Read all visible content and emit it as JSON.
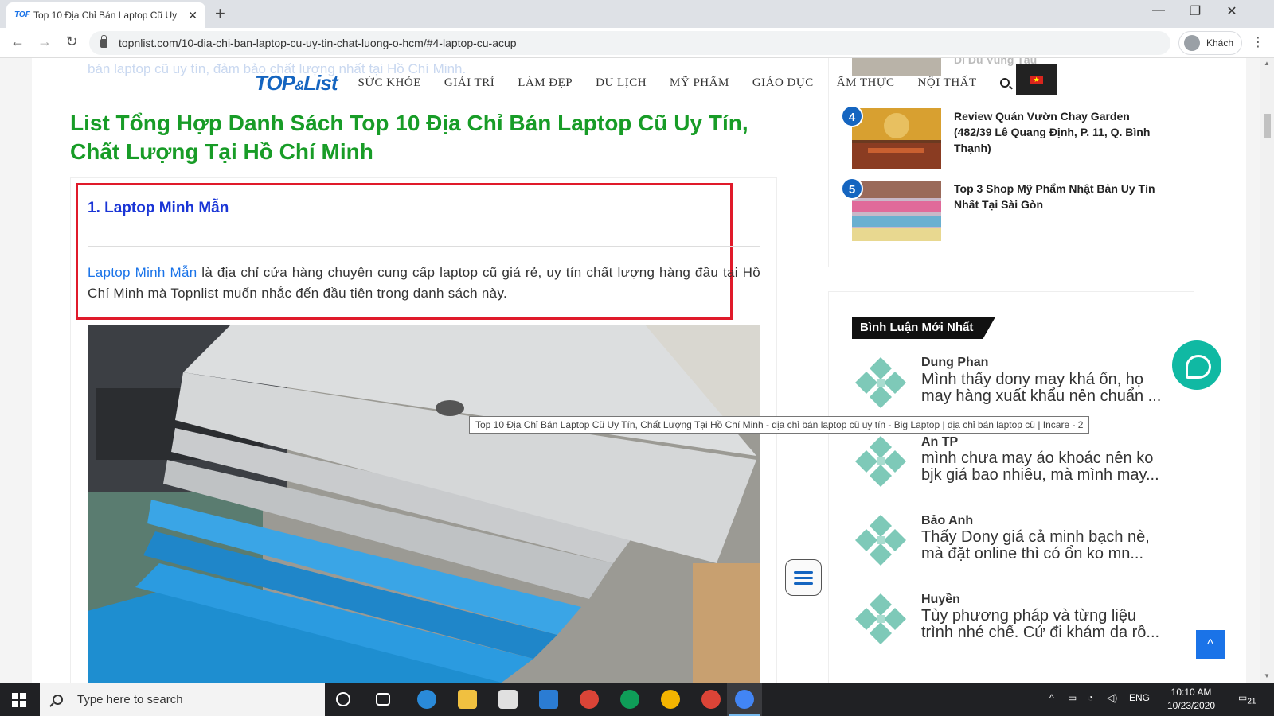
{
  "browser": {
    "tab_title": "Top 10 Địa Chỉ Bán Laptop Cũ Uy",
    "tab_favicon": "TOF",
    "url": "topnlist.com/10-dia-chi-ban-laptop-cu-uy-tin-chat-luong-o-hcm/#4-laptop-cu-acup",
    "profile_label": "Khách"
  },
  "site": {
    "faded_text": "bán laptop cũ uy tín, đảm bảo chất lượng nhất tại Hồ Chí Minh.",
    "logo": {
      "main": "TOP",
      "amp": "&",
      "rest": "List"
    },
    "nav": [
      "SỨC KHỎE",
      "GIẢI TRÍ",
      "LÀM ĐẸP",
      "DU LỊCH",
      "MỸ PHẨM",
      "GIÁO DỤC",
      "ẨM THỰC",
      "NỘI THẤT"
    ],
    "flag": "★"
  },
  "article": {
    "heading": "List Tổng Hợp Danh Sách Top 10 Địa Chỉ Bán Laptop Cũ Uy Tín, Chất Lượng Tại Hồ Chí Minh",
    "item_title": "1. Laptop Minh Mẫn",
    "desc_link": "Laptop Minh Mẫn",
    "desc_rest": " là địa chỉ cửa hàng chuyên cung cấp laptop cũ giá rẻ, uy tín chất lượng hàng đầu tại Hồ Chí Minh mà Topnlist muốn nhắc đến đầu tiên trong danh sách này."
  },
  "sidebar": {
    "partial_text": "Di Dủ Vũng Tàu",
    "top_list": [
      {
        "num": "4",
        "title": "Review Quán Vườn Chay Garden (482/39 Lê Quang Định, P. 11, Q. Bình Thạnh)"
      },
      {
        "num": "5",
        "title": "Top 3 Shop Mỹ Phẩm Nhật Bản Uy Tín Nhất Tại Sài Gòn"
      }
    ],
    "comments_heading": "Bình Luận Mới Nhất",
    "comments": [
      {
        "name": "Dung Phan",
        "text": "Mình thấy dony may khá ổn, họ may hàng xuất khẩu nên chuẩn ..."
      },
      {
        "name": "An TP",
        "text": "mình chưa may áo khoác nên ko bjk giá bao nhiêu, mà mình may..."
      },
      {
        "name": "Bảo Anh",
        "text": "Thấy Dony giá cả minh bạch nè, mà đặt online thì có ổn ko mn..."
      },
      {
        "name": "Huyền",
        "text": "Tùy phương pháp và từng liệu trình nhé chế. Cứ đi khám da rồ..."
      }
    ]
  },
  "tooltip": "Top 10 Địa Chỉ Bán Laptop Cũ Uy Tín, Chất Lượng Tại Hồ Chí Minh - địa chỉ bán laptop cũ uy tín - Big Laptop | địa chỉ bán laptop cũ | Incare - 2",
  "taskbar": {
    "search_placeholder": "Type here to search",
    "lang": "ENG",
    "time": "10:10 AM",
    "date": "10/23/2020",
    "notifications": "21"
  },
  "colors": {
    "heading_green": "#189c27",
    "link_blue": "#1a73e8",
    "highlight_red": "#e01a2a",
    "chat_teal": "#10b9a3"
  }
}
